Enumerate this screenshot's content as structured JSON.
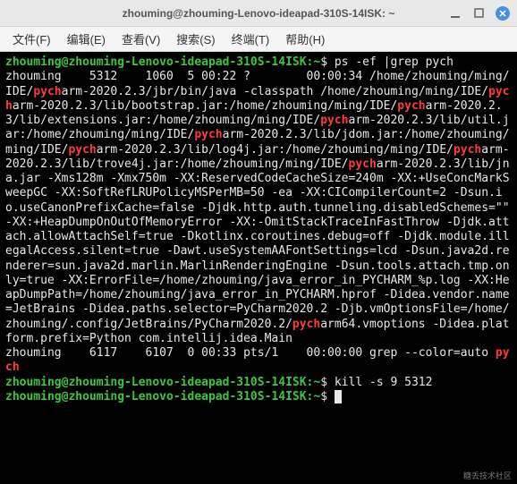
{
  "window": {
    "title": "zhouming@zhouming-Lenovo-ideapad-310S-14ISK: ~"
  },
  "menubar": {
    "items": [
      "文件(F)",
      "编辑(E)",
      "查看(V)",
      "搜索(S)",
      "终端(T)",
      "帮助(H)"
    ]
  },
  "colors": {
    "prompt": "#3ec73e",
    "highlight": "#ff3a3a",
    "text": "#e8e8e8",
    "bg": "#000000"
  },
  "terminal": {
    "prompt_user_host": "zhouming@zhouming-Lenovo-ideapad-310S-14ISK",
    "prompt_path": "~",
    "prompt_suffix": "$",
    "commands": {
      "cmd1": "ps -ef |grep pych",
      "cmd2": "kill -s 9 5312",
      "cmd3": ""
    },
    "ps_output": {
      "row1_prefix": "zhouming    5312    1060  5 00:22 ?        00:00:34 /home/zhouming/ming/IDE/",
      "row1_hl1": "pych",
      "seg1": "arm-2020.2.3/jbr/bin/java -classpath /home/zhouming/ming/IDE/",
      "hl2": "pych",
      "seg2": "arm-2020.2.3/lib/bootstrap.jar:/home/zhouming/ming/IDE/",
      "hl3": "pych",
      "seg3": "arm-2020.2.3/lib/extensions.jar:/home/zhouming/ming/IDE/",
      "hl4": "pych",
      "seg4": "arm-2020.2.3/lib/util.jar:/home/zhouming/ming/IDE/",
      "hl5": "pych",
      "seg5": "arm-2020.2.3/lib/jdom.jar:/home/zhouming/ming/IDE/",
      "hl6": "pych",
      "seg6": "arm-2020.2.3/lib/log4j.jar:/home/zhouming/ming/IDE/",
      "hl7": "pych",
      "seg7": "arm-2020.2.3/lib/trove4j.jar:/home/zhouming/ming/IDE/",
      "hl8": "pych",
      "seg8": "arm-2020.2.3/lib/jna.jar -Xms128m -Xmx750m -XX:ReservedCodeCacheSize=240m -XX:+UseConcMarkSweepGC -XX:SoftRefLRUPolicyMSPerMB=50 -ea -XX:CICompilerCount=2 -Dsun.io.useCanonPrefixCache=false -Djdk.http.auth.tunneling.disabledSchemes=\"\" -XX:+HeapDumpOnOutOfMemoryError -XX:-OmitStackTraceInFastThrow -Djdk.attach.allowAttachSelf=true -Dkotlinx.coroutines.debug=off -Djdk.module.illegalAccess.silent=true -Dawt.useSystemAAFontSettings=lcd -Dsun.java2d.renderer=sun.java2d.marlin.MarlinRenderingEngine -Dsun.tools.attach.tmp.only=true -XX:ErrorFile=/home/zhouming/java_error_in_PYCHARM_%p.log -XX:HeapDumpPath=/home/zhouming/java_error_in_PYCHARM.hprof -Didea.vendor.name=JetBrains -Didea.paths.selector=PyCharm2020.2 -Djb.vmOptionsFile=/home/zhouming/.config/JetBrains/PyCharm2020.2/",
      "hl9": "pych",
      "seg9": "arm64.vmoptions -Didea.platform.prefix=Python com.intellij.idea.Main",
      "row2_prefix": "zhouming    6117    6107  0 00:33 pts/1    00:00:00 grep --color=auto ",
      "row2_hl": "pych"
    }
  },
  "watermark": "糖丢技术社区"
}
